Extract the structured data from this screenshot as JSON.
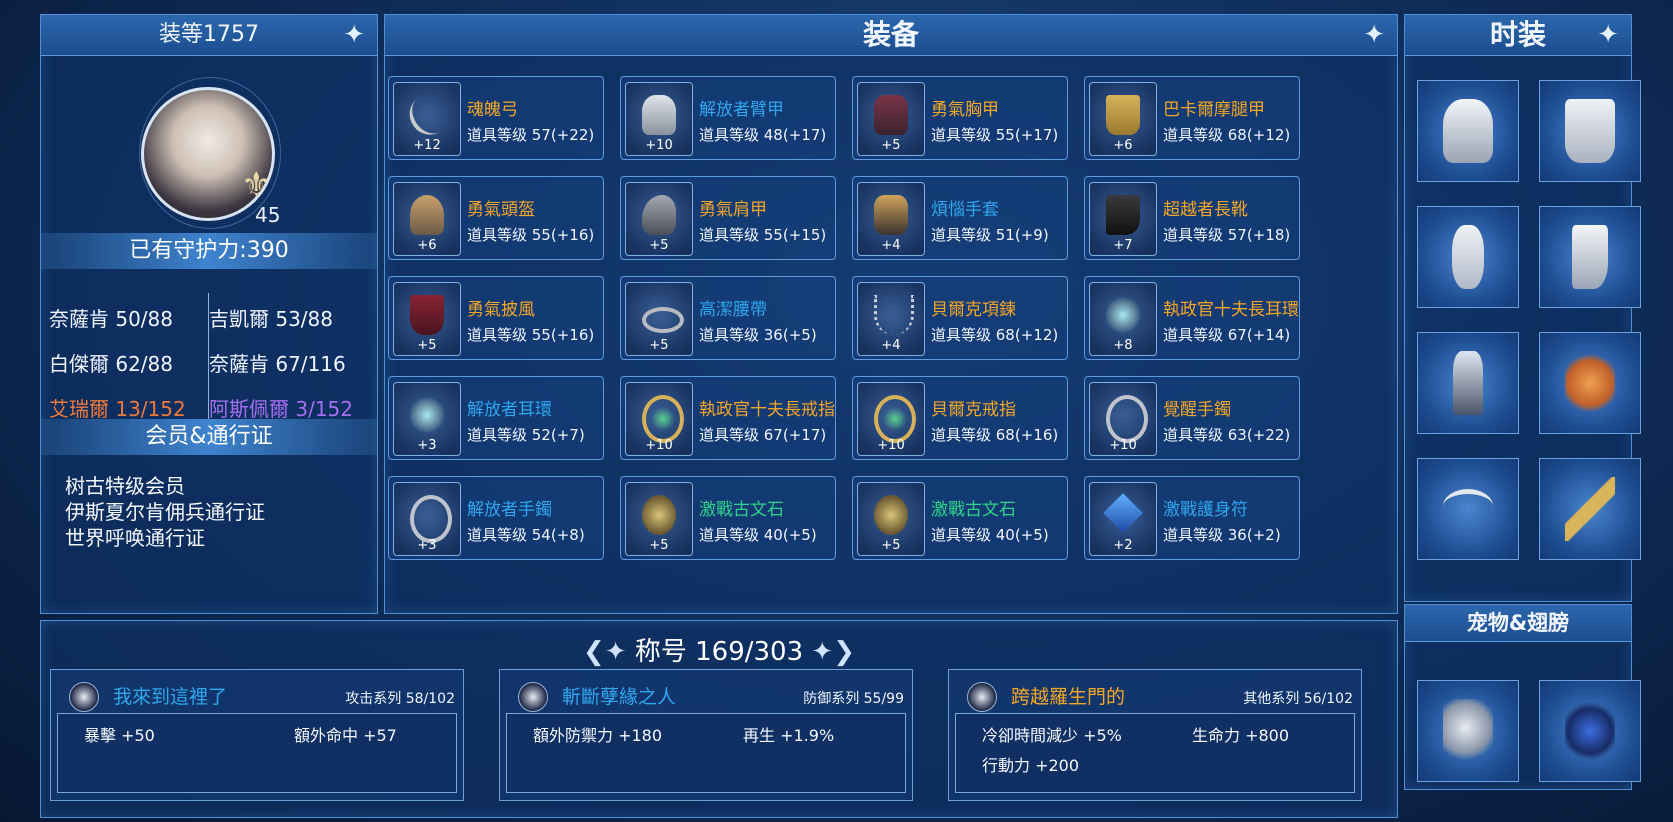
{
  "left": {
    "gear_score": "装等1757",
    "level": "45",
    "guard_power": "已有守护力:390",
    "stats": [
      {
        "text": "奈薩肯 50/88",
        "color": "#f0f4ff"
      },
      {
        "text": "吉凱爾 53/88",
        "color": "#f0f4ff"
      },
      {
        "text": "白傑爾 62/88",
        "color": "#f0f4ff"
      },
      {
        "text": "奈薩肯 67/116",
        "color": "#f0f4ff"
      },
      {
        "text": "艾瑞爾 13/152",
        "color": "#f07a3a"
      },
      {
        "text": "阿斯佩爾 3/152",
        "color": "#a56ff0"
      }
    ],
    "membership_title": "会员&通行证",
    "memberships": [
      "树古特级会员",
      "伊斯夏尔肯佣兵通行证",
      "世界呼唤通行证"
    ]
  },
  "equipment": {
    "title": "装备",
    "items": [
      {
        "name": "魂魄弓",
        "level": "道具等级 57(+22)",
        "plus": "+12",
        "name_color": "#f5a623",
        "icon": "bow-icon"
      },
      {
        "name": "解放者臂甲",
        "level": "道具等级 48(+17)",
        "plus": "+10",
        "name_color": "#2ea7ee",
        "icon": "bracer-icon"
      },
      {
        "name": "勇氣胸甲",
        "level": "道具等级 55(+17)",
        "plus": "+5",
        "name_color": "#f5a623",
        "icon": "chestplate-icon"
      },
      {
        "name": "巴卡爾摩腿甲",
        "level": "道具等级 68(+12)",
        "plus": "+6",
        "name_color": "#f5a623",
        "icon": "leggings-icon"
      },
      {
        "name": "勇氣頭盔",
        "level": "道具等级 55(+16)",
        "plus": "+6",
        "name_color": "#f5a623",
        "icon": "helmet-icon"
      },
      {
        "name": "勇氣肩甲",
        "level": "道具等级 55(+15)",
        "plus": "+5",
        "name_color": "#f5a623",
        "icon": "pauldron-icon"
      },
      {
        "name": "煩惱手套",
        "level": "道具等级 51(+9)",
        "plus": "+4",
        "name_color": "#2ea7ee",
        "icon": "gloves-icon"
      },
      {
        "name": "超越者長靴",
        "level": "道具等级 57(+18)",
        "plus": "+7",
        "name_color": "#f5a623",
        "icon": "boots-icon"
      },
      {
        "name": "勇氣披風",
        "level": "道具等级 55(+16)",
        "plus": "+5",
        "name_color": "#f5a623",
        "icon": "cape-icon"
      },
      {
        "name": "高潔腰帶",
        "level": "道具等级 36(+5)",
        "plus": "+5",
        "name_color": "#2ea7ee",
        "icon": "belt-icon"
      },
      {
        "name": "貝爾克項鍊",
        "level": "道具等级 68(+12)",
        "plus": "+4",
        "name_color": "#f5a623",
        "icon": "necklace-icon"
      },
      {
        "name": "執政官十夫長耳環",
        "level": "道具等级 67(+14)",
        "plus": "+8",
        "name_color": "#f5a623",
        "icon": "earring-icon"
      },
      {
        "name": "解放者耳環",
        "level": "道具等级 52(+7)",
        "plus": "+3",
        "name_color": "#2ea7ee",
        "icon": "earring-icon"
      },
      {
        "name": "執政官十夫長戒指",
        "level": "道具等级 67(+17)",
        "plus": "+10",
        "name_color": "#f5a623",
        "icon": "ring-icon"
      },
      {
        "name": "貝爾克戒指",
        "level": "道具等级 68(+16)",
        "plus": "+10",
        "name_color": "#f5a623",
        "icon": "ring-icon"
      },
      {
        "name": "覺醒手鐲",
        "level": "道具等级 63(+22)",
        "plus": "+10",
        "name_color": "#f5a623",
        "icon": "bracelet-icon"
      },
      {
        "name": "解放者手鐲",
        "level": "道具等级 54(+8)",
        "plus": "+3",
        "name_color": "#2ea7ee",
        "icon": "bracelet-icon"
      },
      {
        "name": "激戰古文石",
        "level": "道具等级 40(+5)",
        "plus": "+5",
        "name_color": "#2ed48a",
        "icon": "runestone-icon"
      },
      {
        "name": "激戰古文石",
        "level": "道具等级 40(+5)",
        "plus": "+5",
        "name_color": "#2ed48a",
        "icon": "runestone-icon"
      },
      {
        "name": "激戰護身符",
        "level": "道具等级 36(+2)",
        "plus": "+2",
        "name_color": "#2ea7ee",
        "icon": "amulet-icon"
      }
    ]
  },
  "fashion": {
    "title": "时装",
    "slots": [
      "costume-top-icon",
      "costume-pants-icon",
      "costume-gloves-icon",
      "costume-boots-icon",
      "costume-cape-icon",
      "costume-companion-icon",
      "costume-tiara-icon",
      "costume-weapon-icon"
    ],
    "pet_title": "宠物&翅膀",
    "pets": [
      "pet-dragon-icon",
      "wings-icon"
    ]
  },
  "titles": {
    "header": "称号 169/303",
    "cards": [
      {
        "name": "我來到這裡了",
        "series": "攻击系列 58/102",
        "icon": "sword-icon",
        "effects": [
          "暴擊 +50",
          "額外命中 +57"
        ]
      },
      {
        "name": "斬斷孽緣之人",
        "series": "防御系列 55/99",
        "icon": "shield-icon",
        "effects": [
          "額外防禦力 +180",
          "再生 +1.9%"
        ]
      },
      {
        "name": "跨越羅生門的",
        "series": "其他系列 56/102",
        "icon": "emblem-icon",
        "effects": [
          "冷卻時間減少 +5%",
          "生命力 +800",
          "行動力 +200"
        ]
      }
    ],
    "card_name_colors": [
      "#2ea7ee",
      "#2ea7ee",
      "#f5a623"
    ]
  }
}
